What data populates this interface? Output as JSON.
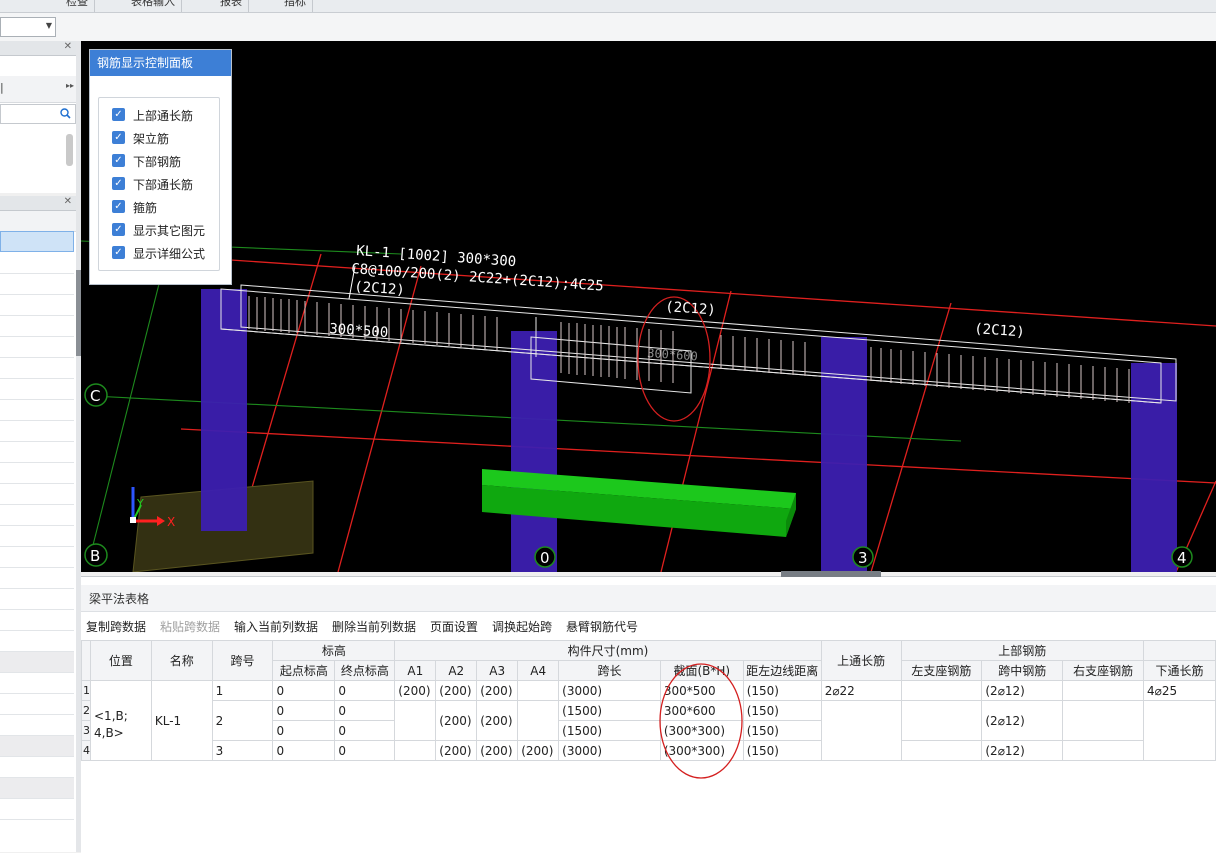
{
  "top_tabs": [
    "检查",
    "表格输入",
    "报表",
    "指标"
  ],
  "control_panel": {
    "title": "钢筋显示控制面板",
    "items": [
      {
        "label": "上部通长筋",
        "checked": true
      },
      {
        "label": "架立筋",
        "checked": true
      },
      {
        "label": "下部钢筋",
        "checked": true
      },
      {
        "label": "下部通长筋",
        "checked": true
      },
      {
        "label": "箍筋",
        "checked": true
      },
      {
        "label": "显示其它图元",
        "checked": true
      },
      {
        "label": "显示详细公式",
        "checked": true
      }
    ]
  },
  "viewport": {
    "beam_label_line1": "KL-1 [1002] 300*300",
    "beam_label_line2": "C8@100/200(2) 2C22+(2C12);4C25",
    "beam_label_line3": "(2C12)",
    "span_label_1": "300*500",
    "span_label_2": "(2C12)",
    "span_label_3": "300*600",
    "span_label_4": "(2C12)",
    "axis_c": "C",
    "axis_b": "B",
    "axis_0": "0",
    "axis_3": "3",
    "axis_4": "4",
    "gizmo_x": "X",
    "gizmo_y": "Y"
  },
  "bottom_panel": {
    "title": "梁平法表格",
    "toolbar": [
      {
        "label": "复制跨数据",
        "enabled": true
      },
      {
        "label": "粘贴跨数据",
        "enabled": false
      },
      {
        "label": "输入当前列数据",
        "enabled": true
      },
      {
        "label": "删除当前列数据",
        "enabled": true
      },
      {
        "label": "页面设置",
        "enabled": true
      },
      {
        "label": "调换起始跨",
        "enabled": true
      },
      {
        "label": "悬臂钢筋代号",
        "enabled": true
      }
    ],
    "headers": {
      "position": "位置",
      "name": "名称",
      "span_no": "跨号",
      "elevation": "标高",
      "start_elev": "起点标高",
      "end_elev": "终点标高",
      "dims": "构件尺寸(mm)",
      "a1": "A1",
      "a2": "A2",
      "a3": "A3",
      "a4": "A4",
      "span_len": "跨长",
      "section": "截面(B*H)",
      "dist_left": "距左边线距离",
      "top_through": "上通长筋",
      "top_rebar": "上部钢筋",
      "left_support": "左支座钢筋",
      "mid_span": "跨中钢筋",
      "right_support": "右支座钢筋",
      "bottom_through": "下通长筋"
    },
    "merged": {
      "position": "<1,B;4,B>",
      "position_l1": "<1,B;",
      "position_l2": "4,B>",
      "name": "KL-1",
      "top_through": "2⌀22",
      "bottom_through": "4⌀25"
    },
    "rows": [
      {
        "rn": "1",
        "span": "1",
        "start": "0",
        "end": "0",
        "a1": "(200)",
        "a2": "(200)",
        "a3": "(200)",
        "a4": "",
        "len": "(3000)",
        "section": "300*500",
        "dist": "(150)",
        "mid": "(2⌀12)"
      },
      {
        "rn": "2",
        "span": "2",
        "start": "0",
        "end": "0",
        "a1": "",
        "a2": "(200)",
        "a3": "(200)",
        "a4": "",
        "len": "(1500)",
        "section": "300*600",
        "dist": "(150)",
        "mid": "(2⌀12)"
      },
      {
        "rn": "3",
        "span": "",
        "start": "0",
        "end": "0",
        "a1": "",
        "a2": "",
        "a3": "",
        "a4": "",
        "len": "(1500)",
        "section": "(300*300)",
        "dist": "(150)",
        "mid": ""
      },
      {
        "rn": "4",
        "span": "3",
        "start": "0",
        "end": "0",
        "a1": "",
        "a2": "(200)",
        "a3": "(200)",
        "a4": "(200)",
        "len": "(3000)",
        "section": "(300*300)",
        "dist": "(150)",
        "mid": "(2⌀12)"
      }
    ]
  },
  "colors": {
    "accent": "#3d7fd6",
    "grid_red": "#e0201e",
    "grid_green": "#1d8a1d",
    "column_purple": "#3c1fb0",
    "beam_green": "#10b410",
    "annotation_red": "#d42020"
  }
}
